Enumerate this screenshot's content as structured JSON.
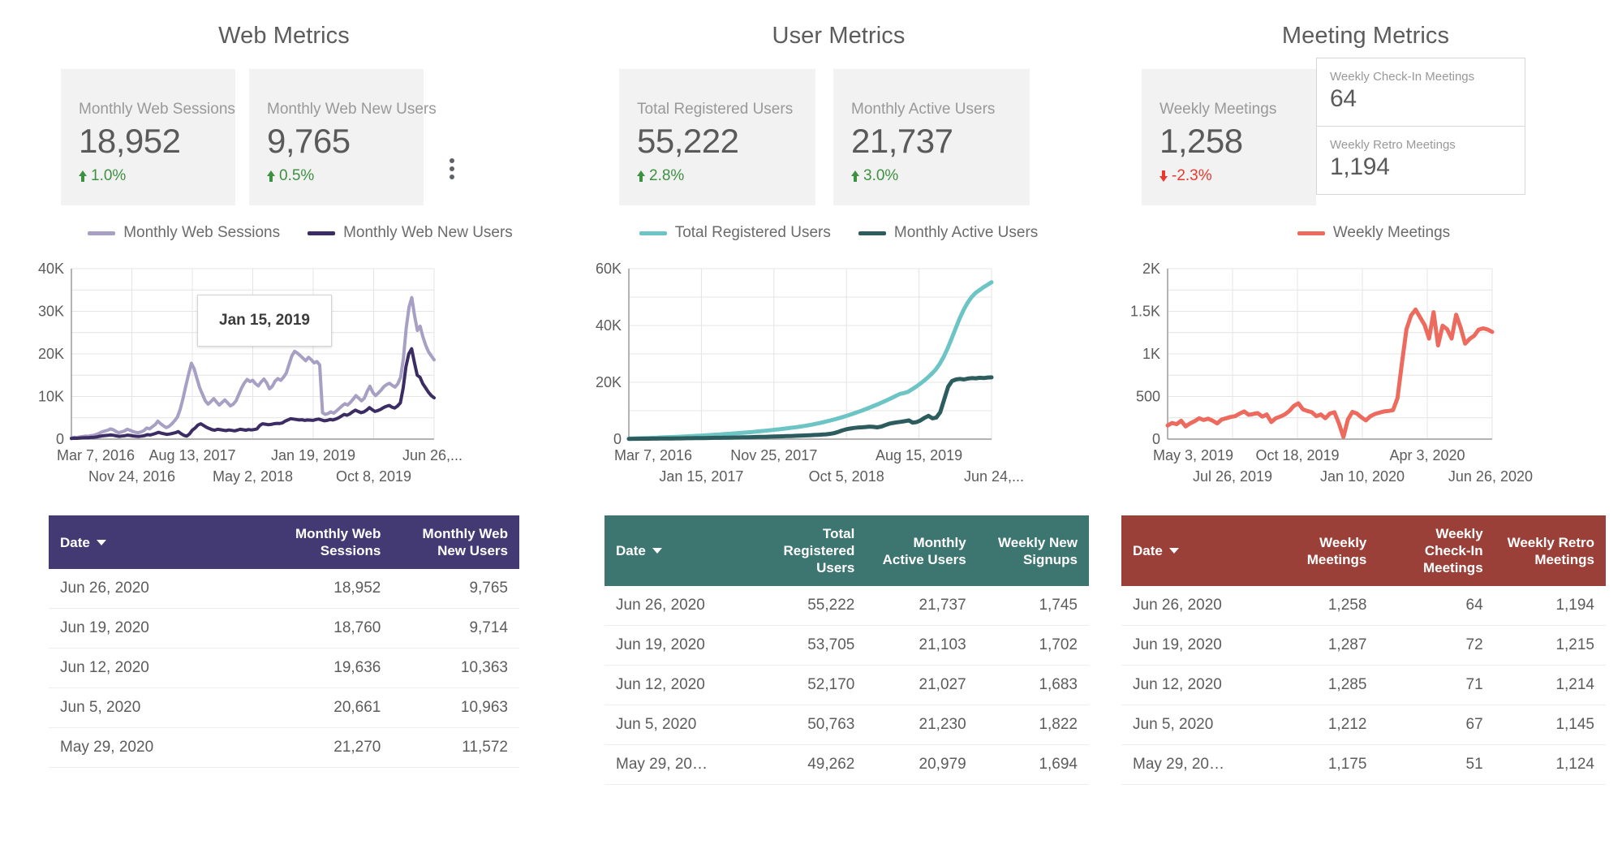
{
  "panels": [
    {
      "key": "web",
      "title": "Web Metrics",
      "accent": "#443a73",
      "scorecards": [
        {
          "label": "Monthly Web Sessions",
          "value": "18,952",
          "delta": "1.0%",
          "direction": "up"
        },
        {
          "label": "Monthly Web New Users",
          "value": "9,765",
          "delta": "0.5%",
          "direction": "up"
        }
      ],
      "menu_icon": "more-vert-icon",
      "legend": [
        {
          "label": "Monthly Web Sessions",
          "color": "#a79fc4"
        },
        {
          "label": "Monthly Web New Users",
          "color": "#3b2d63"
        }
      ],
      "axis": {
        "y_ticks": [
          "40K",
          "30K",
          "20K",
          "10K",
          "0"
        ],
        "x_ticks_row1": [
          "Mar 7, 2016",
          "Aug 13, 2017",
          "Jan 19, 2019",
          "Jun 26,..."
        ],
        "x_ticks_row2": [
          "Nov 24, 2016",
          "May 2, 2018",
          "Oct 8, 2019"
        ]
      },
      "tooltip": "Jan 15, 2019",
      "table": {
        "columns": [
          "Date",
          "Monthly Web Sessions",
          "Monthly Web New Users"
        ],
        "sort_column": "Date",
        "rows": [
          [
            "Jun 26, 2020",
            "18,952",
            "9,765"
          ],
          [
            "Jun 19, 2020",
            "18,760",
            "9,714"
          ],
          [
            "Jun 12, 2020",
            "19,636",
            "10,363"
          ],
          [
            "Jun 5, 2020",
            "20,661",
            "10,963"
          ],
          [
            "May 29, 2020",
            "21,270",
            "11,572"
          ]
        ]
      }
    },
    {
      "key": "user",
      "title": "User Metrics",
      "accent": "#3d7671",
      "scorecards": [
        {
          "label": "Total Registered Users",
          "value": "55,222",
          "delta": "2.8%",
          "direction": "up"
        },
        {
          "label": "Monthly Active Users",
          "value": "21,737",
          "delta": "3.0%",
          "direction": "up"
        }
      ],
      "legend": [
        {
          "label": "Total Registered Users",
          "color": "#6cc4c4"
        },
        {
          "label": "Monthly Active Users",
          "color": "#2d5c5f"
        }
      ],
      "axis": {
        "y_ticks": [
          "60K",
          "40K",
          "20K",
          "0"
        ],
        "x_ticks_row1": [
          "Mar 7, 2016",
          "Nov 25, 2017",
          "Aug 15, 2019"
        ],
        "x_ticks_row2": [
          "Jan 15, 2017",
          "Oct 5, 2018",
          "Jun 24,..."
        ]
      },
      "table": {
        "columns": [
          "Date",
          "Total Registered Users",
          "Monthly Active Users",
          "Weekly New Signups"
        ],
        "sort_column": "Date",
        "rows": [
          [
            "Jun 26, 2020",
            "55,222",
            "21,737",
            "1,745"
          ],
          [
            "Jun 19, 2020",
            "53,705",
            "21,103",
            "1,702"
          ],
          [
            "Jun 12, 2020",
            "52,170",
            "21,027",
            "1,683"
          ],
          [
            "Jun 5, 2020",
            "50,763",
            "21,230",
            "1,822"
          ],
          [
            "May 29, 20…",
            "49,262",
            "20,979",
            "1,694"
          ]
        ]
      }
    },
    {
      "key": "meeting",
      "title": "Meeting Metrics",
      "accent": "#9b4039",
      "scorecards": [
        {
          "label": "Weekly Meetings",
          "value": "1,258",
          "delta": "-2.3%",
          "direction": "down"
        }
      ],
      "mini_scorecards": [
        {
          "label": "Weekly Check-In Meetings",
          "value": "64"
        },
        {
          "label": "Weekly Retro Meetings",
          "value": "1,194"
        }
      ],
      "legend": [
        {
          "label": "Weekly Meetings",
          "color": "#ec6b5e"
        }
      ],
      "axis": {
        "y_ticks": [
          "2K",
          "1.5K",
          "1K",
          "500",
          "0"
        ],
        "x_ticks_row1": [
          "May 3, 2019",
          "Oct 18, 2019",
          "Apr 3, 2020"
        ],
        "x_ticks_row2": [
          "Jul 26, 2019",
          "Jan 10, 2020",
          "Jun 26, 2020"
        ]
      },
      "table": {
        "columns": [
          "Date",
          "Weekly Meetings",
          "Weekly Check-In Meetings",
          "Weekly Retro Meetings"
        ],
        "sort_column": "Date",
        "rows": [
          [
            "Jun 26, 2020",
            "1,258",
            "64",
            "1,194"
          ],
          [
            "Jun 19, 2020",
            "1,287",
            "72",
            "1,215"
          ],
          [
            "Jun 12, 2020",
            "1,285",
            "71",
            "1,214"
          ],
          [
            "Jun 5, 2020",
            "1,212",
            "67",
            "1,145"
          ],
          [
            "May 29, 20…",
            "1,175",
            "51",
            "1,124"
          ]
        ]
      }
    }
  ],
  "chart_data": [
    {
      "type": "line",
      "title": "Web Metrics",
      "xlabel": "",
      "ylabel": "",
      "ylim": [
        0,
        40000
      ],
      "y_ticks": [
        0,
        10000,
        20000,
        30000,
        40000
      ],
      "x_range": [
        "Mar 7, 2016",
        "Jun 26, 2020"
      ],
      "x_ticks": [
        "Mar 7, 2016",
        "Nov 24, 2016",
        "Aug 13, 2017",
        "May 2, 2018",
        "Jan 19, 2019",
        "Oct 8, 2019",
        "Jun 26, 2020"
      ],
      "grid": true,
      "legend_position": "top",
      "annotation": "Jan 15, 2019",
      "series": [
        {
          "name": "Monthly Web Sessions",
          "color": "#a79fc4",
          "values": [
            300,
            420,
            380,
            520,
            610,
            700,
            650,
            820,
            900,
            1100,
            1400,
            1700,
            1900,
            2100,
            2400,
            2200,
            1800,
            1500,
            1700,
            1900,
            2300,
            2100,
            1800,
            1600,
            1500,
            1700,
            2000,
            2600,
            2400,
            2900,
            3400,
            4200,
            3600,
            3100,
            2700,
            3000,
            3600,
            4300,
            5200,
            7000,
            9500,
            12500,
            15200,
            17800,
            16500,
            14200,
            12000,
            10500,
            9000,
            8200,
            8800,
            9500,
            8700,
            8000,
            8600,
            9200,
            8500,
            7800,
            8200,
            9000,
            10500,
            12000,
            13200,
            14000,
            13500,
            13800,
            13000,
            12500,
            13400,
            14100,
            13200,
            11800,
            12400,
            13600,
            14200,
            13800,
            14500,
            15500,
            17500,
            19500,
            20600,
            20200,
            19600,
            19000,
            18400,
            19200,
            18600,
            17900,
            18200,
            17400,
            6200,
            5800,
            6000,
            6400,
            6100,
            6600,
            7200,
            7800,
            8300,
            8000,
            8600,
            9400,
            10200,
            9600,
            9000,
            9600,
            11200,
            12400,
            11000,
            10200,
            10800,
            11500,
            12300,
            12800,
            13100,
            12600,
            12200,
            13000,
            14500,
            19000,
            26000,
            31000,
            33200,
            29000,
            25500,
            26500,
            24000,
            22000,
            20500,
            19500,
            18600
          ]
        },
        {
          "name": "Monthly Web New Users",
          "color": "#3b2d63",
          "values": [
            150,
            210,
            190,
            260,
            300,
            340,
            320,
            400,
            440,
            520,
            640,
            760,
            840,
            900,
            980,
            900,
            760,
            640,
            720,
            800,
            940,
            860,
            740,
            660,
            620,
            700,
            820,
            1050,
            980,
            1150,
            1350,
            1600,
            1400,
            1250,
            1100,
            1200,
            1350,
            1500,
            1750,
            1300,
            900,
            700,
            1200,
            2100,
            2600,
            3300,
            3600,
            3200,
            2800,
            2500,
            2200,
            2100,
            2300,
            2200,
            2100,
            2000,
            2150,
            2050,
            1950,
            2100,
            2300,
            2200,
            2100,
            2250,
            2150,
            2250,
            2400,
            3200,
            3600,
            3500,
            3400,
            3450,
            3600,
            3700,
            3650,
            3800,
            4200,
            4500,
            4800,
            4700,
            4600,
            4500,
            4550,
            4400,
            4500,
            4450,
            4400,
            4600,
            4700,
            4500,
            4300,
            4400,
            4600,
            4500,
            4700,
            5000,
            5400,
            5800,
            5600,
            5900,
            6400,
            6800,
            6500,
            6200,
            6400,
            6800,
            7400,
            6900,
            6500,
            6700,
            7000,
            7400,
            7700,
            7900,
            7500,
            7300,
            7800,
            8500,
            12000,
            17000,
            20000,
            21200,
            18000,
            15000,
            14500,
            13000,
            12000,
            11000,
            10200,
            9700
          ]
        }
      ]
    },
    {
      "type": "line",
      "title": "User Metrics",
      "xlabel": "",
      "ylabel": "",
      "ylim": [
        0,
        60000
      ],
      "y_ticks": [
        0,
        20000,
        40000,
        60000
      ],
      "x_range": [
        "Mar 7, 2016",
        "Jun 24, 2020"
      ],
      "x_ticks": [
        "Mar 7, 2016",
        "Jan 15, 2017",
        "Nov 25, 2017",
        "Oct 5, 2018",
        "Aug 15, 2019",
        "Jun 24, 2020"
      ],
      "grid": true,
      "legend_position": "top",
      "series": [
        {
          "name": "Total Registered Users",
          "color": "#6cc4c4",
          "values": [
            200,
            240,
            280,
            320,
            360,
            400,
            450,
            500,
            560,
            620,
            680,
            740,
            800,
            870,
            940,
            1010,
            1080,
            1160,
            1240,
            1320,
            1400,
            1490,
            1580,
            1670,
            1760,
            1860,
            1960,
            2060,
            2170,
            2280,
            2400,
            2520,
            2650,
            2780,
            2920,
            3060,
            3210,
            3360,
            3520,
            3680,
            3850,
            4020,
            4200,
            4400,
            4620,
            4860,
            5120,
            5400,
            5700,
            6020,
            6360,
            6720,
            7100,
            7500,
            7920,
            8360,
            8820,
            9300,
            9800,
            10320,
            10860,
            11420,
            12000,
            12600,
            13220,
            13860,
            14520,
            15200,
            15900,
            16200,
            16600,
            17500,
            18400,
            19400,
            20500,
            21700,
            23000,
            24500,
            26500,
            29000,
            32000,
            35500,
            39000,
            42500,
            45500,
            48000,
            50000,
            51500,
            52500,
            53500,
            54300,
            55222
          ]
        },
        {
          "name": "Monthly Active Users",
          "color": "#2d5c5f",
          "values": [
            100,
            110,
            120,
            130,
            140,
            150,
            160,
            175,
            190,
            205,
            220,
            235,
            250,
            265,
            280,
            300,
            320,
            340,
            360,
            380,
            400,
            420,
            445,
            470,
            495,
            520,
            550,
            580,
            610,
            640,
            670,
            700,
            735,
            770,
            805,
            840,
            880,
            920,
            960,
            1000,
            1050,
            1100,
            1150,
            1200,
            1260,
            1320,
            1380,
            1450,
            1520,
            1600,
            1700,
            1850,
            2100,
            2500,
            3000,
            3400,
            3700,
            3900,
            4050,
            4150,
            4250,
            4400,
            4300,
            4150,
            4400,
            4900,
            5400,
            5700,
            5900,
            6100,
            6300,
            6600,
            5800,
            6000,
            6600,
            7500,
            8200,
            7300,
            7600,
            9500,
            14000,
            18500,
            20500,
            21000,
            21200,
            21000,
            21300,
            21500,
            21400,
            21600,
            21500,
            21700,
            21737
          ]
        }
      ]
    },
    {
      "type": "line",
      "title": "Meeting Metrics",
      "xlabel": "",
      "ylabel": "",
      "ylim": [
        0,
        2000
      ],
      "y_ticks": [
        0,
        500,
        1000,
        1500,
        2000
      ],
      "x_range": [
        "May 3, 2019",
        "Jun 26, 2020"
      ],
      "x_ticks": [
        "May 3, 2019",
        "Jul 26, 2019",
        "Oct 18, 2019",
        "Jan 10, 2020",
        "Apr 3, 2020",
        "Jun 26, 2020"
      ],
      "grid": true,
      "legend_position": "top",
      "series": [
        {
          "name": "Weekly Meetings",
          "color": "#ec6b5e",
          "values": [
            160,
            190,
            175,
            215,
            150,
            185,
            210,
            245,
            225,
            240,
            215,
            185,
            230,
            245,
            260,
            270,
            300,
            325,
            285,
            295,
            305,
            265,
            290,
            200,
            245,
            265,
            290,
            330,
            390,
            420,
            350,
            330,
            315,
            270,
            290,
            245,
            300,
            315,
            185,
            25,
            230,
            320,
            300,
            255,
            220,
            270,
            295,
            310,
            325,
            330,
            340,
            480,
            900,
            1290,
            1450,
            1520,
            1430,
            1340,
            1180,
            1490,
            1100,
            1330,
            1290,
            1180,
            1460,
            1310,
            1120,
            1175,
            1212,
            1285,
            1300,
            1287,
            1258
          ]
        }
      ]
    }
  ]
}
